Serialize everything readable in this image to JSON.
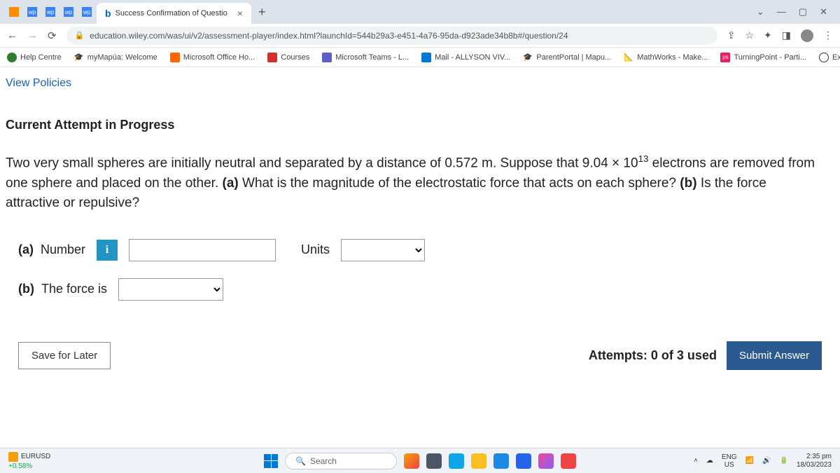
{
  "browser": {
    "tab_title": "Success Confirmation of Questio",
    "url": "education.wiley.com/was/ui/v2/assessment-player/index.html?launchId=544b29a3-e451-4a76-95da-d923ade34b8b#/question/24"
  },
  "bookmarks": {
    "help": "Help Centre",
    "mapua": "myMapúa: Welcome",
    "office": "Microsoft Office Ho...",
    "courses": "Courses",
    "teams": "Microsoft Teams - L...",
    "mail": "Mail - ALLYSON VIV...",
    "parent": "ParentPortal | Mapu...",
    "mathworks": "MathWorks - Make...",
    "turning": "TurningPoint - Parti...",
    "github": "Explore GitHub"
  },
  "page": {
    "view_policies": "View Policies",
    "section_title": "Current Attempt in Progress",
    "question_pre": "Two very small spheres are initially neutral and separated by a distance of 0.572 m. Suppose that 9.04 × 10",
    "question_exp": "13",
    "question_post": " electrons are removed from one sphere and placed on the other. ",
    "part_a_bold": "(a)",
    "part_a_text": " What is the magnitude of the electrostatic force that acts on each sphere? ",
    "part_b_bold": "(b)",
    "part_b_text": " Is the force attractive or repulsive?",
    "label_a": "(a)",
    "label_number": "Number",
    "info": "i",
    "label_units": "Units",
    "label_b": "(b)",
    "label_force": "The force is",
    "save": "Save for Later",
    "attempts": "Attempts: 0 of 3 used",
    "submit": "Submit Answer"
  },
  "taskbar": {
    "stock_sym": "EURUSD",
    "stock_val": "+0.58%",
    "search": "Search",
    "lang_top": "ENG",
    "lang_bot": "US",
    "time": "2:35 pm",
    "date": "18/03/2023",
    "ps": "ps"
  }
}
